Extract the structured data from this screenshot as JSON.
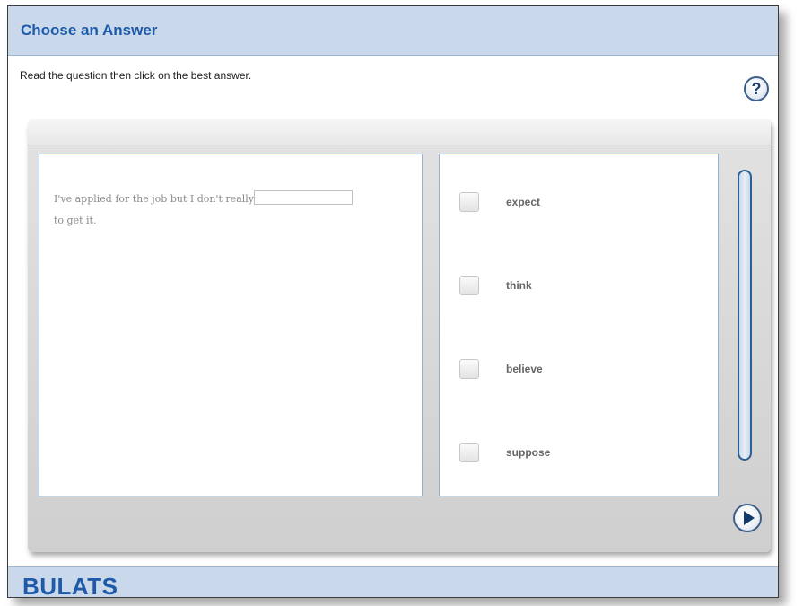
{
  "header": {
    "title": "Choose an Answer"
  },
  "instructions": "Read the question then click on the best answer.",
  "help": {
    "label": "?"
  },
  "question": {
    "before_blank": "I've applied for the job but I don't really",
    "after_blank": "to get it."
  },
  "answers": [
    {
      "label": "expect"
    },
    {
      "label": "think"
    },
    {
      "label": "believe"
    },
    {
      "label": "suppose"
    }
  ],
  "footer": {
    "brand": "BULATS"
  },
  "colors": {
    "header_bg": "#c9d8ea",
    "title_blue": "#1e5aa8",
    "panel_grey": "#d6d6d6",
    "border_blue": "#8fb3d6"
  }
}
